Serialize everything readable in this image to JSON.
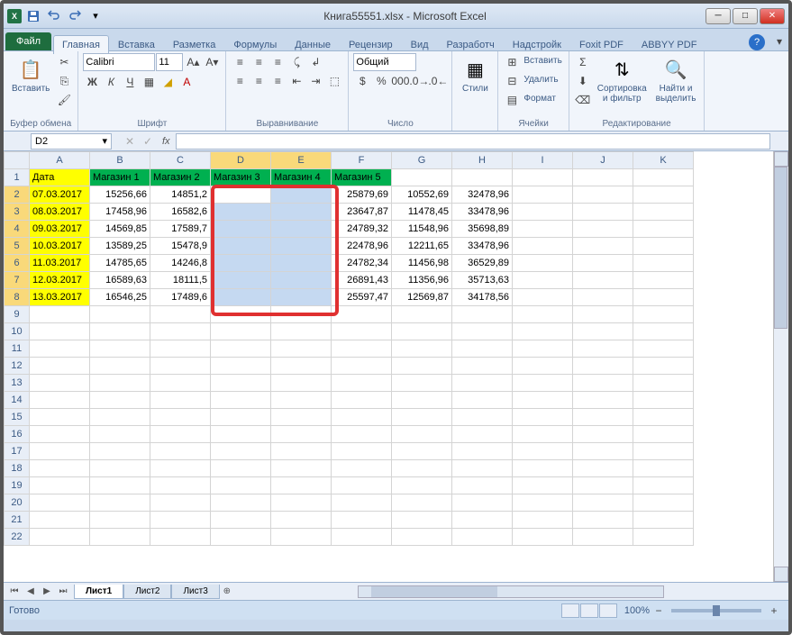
{
  "window": {
    "title": "Книга55551.xlsx - Microsoft Excel"
  },
  "qat": {
    "save_icon": "save-icon",
    "undo_icon": "undo-icon",
    "redo_icon": "redo-icon"
  },
  "tabs": {
    "file": "Файл",
    "items": [
      "Главная",
      "Вставка",
      "Разметка",
      "Формулы",
      "Данные",
      "Рецензир",
      "Вид",
      "Разработч",
      "Надстройк",
      "Foxit PDF",
      "ABBYY PDF"
    ],
    "active_index": 0
  },
  "ribbon": {
    "clipboard": {
      "paste": "Вставить",
      "label": "Буфер обмена"
    },
    "font": {
      "name": "Calibri",
      "size": "11",
      "bold": "Ж",
      "italic": "К",
      "underline": "Ч",
      "label": "Шрифт"
    },
    "align": {
      "label": "Выравнивание"
    },
    "number": {
      "format": "Общий",
      "label": "Число"
    },
    "styles": {
      "btn": "Стили",
      "label": ""
    },
    "cells": {
      "insert": "Вставить",
      "delete": "Удалить",
      "format": "Формат",
      "label": "Ячейки"
    },
    "editing": {
      "sort": "Сортировка\nи фильтр",
      "find": "Найти и\nвыделить",
      "label": "Редактирование"
    }
  },
  "namebox": "D2",
  "formula": "",
  "columns": [
    "A",
    "B",
    "C",
    "D",
    "E",
    "F",
    "G",
    "H",
    "I",
    "J",
    "K"
  ],
  "selected_cols": [
    "D",
    "E"
  ],
  "selected_rows": [
    2,
    3,
    4,
    5,
    6,
    7,
    8
  ],
  "headers": [
    "Дата",
    "Магазин 1",
    "Магазин 2",
    "Магазин 3",
    "Магазин 4",
    "Магазин 5"
  ],
  "rows": [
    {
      "r": 2,
      "date": "07.03.2017",
      "v": [
        "15256,66",
        "14851,2",
        "",
        "",
        "25879,69",
        "10552,69",
        "32478,96"
      ]
    },
    {
      "r": 3,
      "date": "08.03.2017",
      "v": [
        "17458,96",
        "16582,6",
        "",
        "",
        "23647,87",
        "11478,45",
        "33478,96"
      ]
    },
    {
      "r": 4,
      "date": "09.03.2017",
      "v": [
        "14569,85",
        "17589,7",
        "",
        "",
        "24789,32",
        "11548,96",
        "35698,89"
      ]
    },
    {
      "r": 5,
      "date": "10.03.2017",
      "v": [
        "13589,25",
        "15478,9",
        "",
        "",
        "22478,96",
        "12211,65",
        "33478,96"
      ]
    },
    {
      "r": 6,
      "date": "11.03.2017",
      "v": [
        "14785,65",
        "14246,8",
        "",
        "",
        "24782,34",
        "11456,98",
        "36529,89"
      ]
    },
    {
      "r": 7,
      "date": "12.03.2017",
      "v": [
        "16589,63",
        "18111,5",
        "",
        "",
        "26891,43",
        "11356,96",
        "35713,63"
      ]
    },
    {
      "r": 8,
      "date": "13.03.2017",
      "v": [
        "16546,25",
        "17489,6",
        "",
        "",
        "25597,47",
        "12569,87",
        "34178,56"
      ]
    }
  ],
  "empty_rows": [
    9,
    10,
    11,
    12,
    13,
    14,
    15,
    16,
    17,
    18,
    19,
    20,
    21,
    22
  ],
  "sheets": {
    "items": [
      "Лист1",
      "Лист2",
      "Лист3"
    ],
    "active_index": 0
  },
  "status": {
    "ready": "Готово",
    "zoom": "100%"
  }
}
